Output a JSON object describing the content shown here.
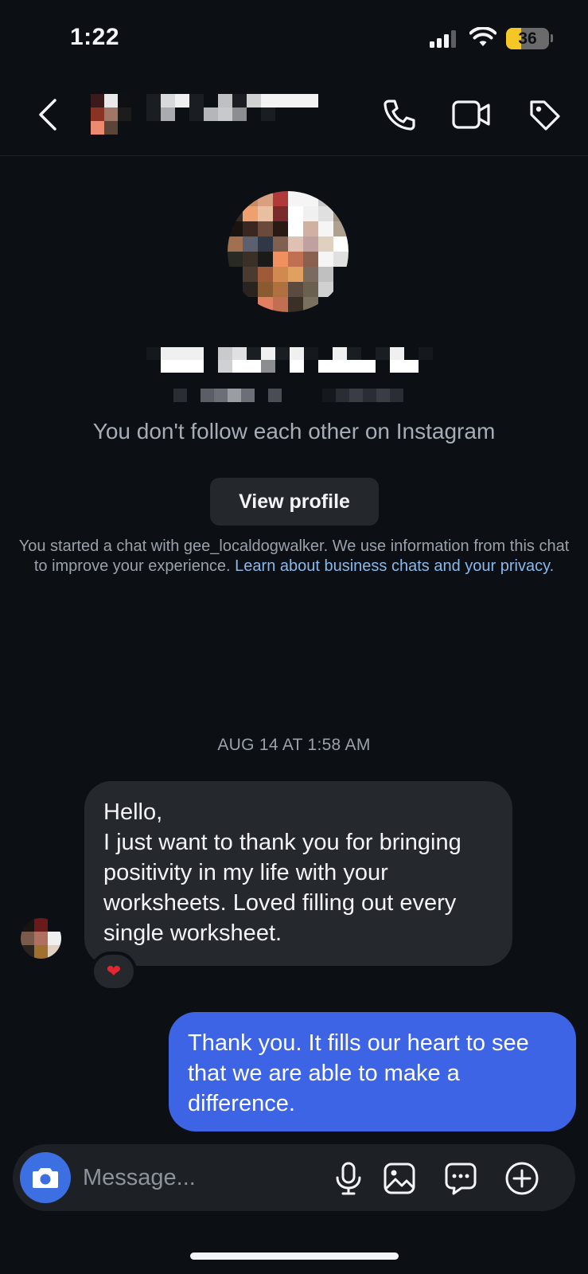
{
  "status_bar": {
    "time": "1:22",
    "battery": "36",
    "battery_color": "#f5c724",
    "icons": [
      "signal-icon",
      "wifi-icon",
      "battery-icon"
    ]
  },
  "header": {
    "icons": [
      "back-icon",
      "phone-icon",
      "video-icon",
      "tag-icon"
    ]
  },
  "profile": {
    "relationship_text": "You don't follow each other on Instagram",
    "view_profile_label": "View profile"
  },
  "info": {
    "text": "You started a chat with gee_localdogwalker. We use information from this chat to improve your experience. ",
    "link": "Learn about business chats and your privacy."
  },
  "conversation": {
    "timestamp": "AUG 14 AT 1:58 AM",
    "messages": [
      {
        "direction": "incoming",
        "text": "Hello,\nI just want to thank you for bringing positivity in my life with your worksheets. Loved filling out every single worksheet.",
        "reaction": "❤"
      },
      {
        "direction": "outgoing",
        "text": "Thank you. It fills our heart to see that we are able to make a difference."
      }
    ]
  },
  "composer": {
    "placeholder": "Message...",
    "icons": [
      "camera-icon",
      "microphone-icon",
      "gallery-icon",
      "sticker-icon",
      "plus-icon"
    ]
  },
  "colors": {
    "background": "#0c1015",
    "incoming_bubble": "#25282d",
    "outgoing_bubble": "#3c64e4",
    "link": "#8ab8e8",
    "camera_button": "#3b6fe2"
  }
}
